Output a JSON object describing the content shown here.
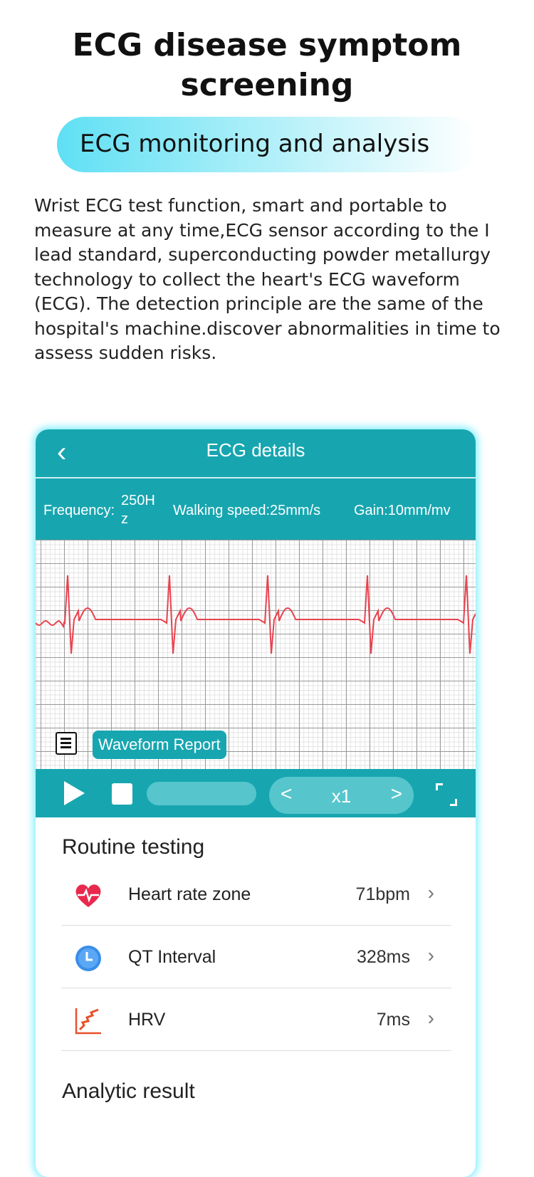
{
  "page": {
    "title": "ECG disease symptom screening",
    "subtitle": "ECG monitoring and analysis",
    "description": "Wrist ECG test function, smart and portable to measure at any time,ECG sensor according to the I lead standard, superconducting powder metallurgy technology to collect the heart's ECG waveform (ECG). The detection principle are the same of the hospital's machine.discover abnormalities in time to assess sudden risks."
  },
  "app": {
    "header_title": "ECG details",
    "back_icon": "chevron-left-icon",
    "info": {
      "frequency_label": "Frequency:",
      "frequency_value_top": "250H",
      "frequency_value_bottom": "z",
      "walking_speed": "Walking speed:25mm/s",
      "gain": "Gain:10mm/mv"
    },
    "waveform_report_label": "Waveform Report",
    "controls": {
      "speed_value": "x1",
      "prev": "<",
      "next": ">"
    },
    "routine_title": "Routine testing",
    "rows": [
      {
        "label": "Heart rate zone",
        "value": "71bpm",
        "icon": "heart-pulse-icon"
      },
      {
        "label": "QT Interval",
        "value": "328ms",
        "icon": "clock-icon"
      },
      {
        "label": "HRV",
        "value": "7ms",
        "icon": "hrv-chart-icon"
      }
    ],
    "chevron": "›",
    "analytic_title": "Analytic result"
  },
  "colors": {
    "teal": "#17a6b0",
    "ecg_line": "#e8434f",
    "glow": "#8ff0ff"
  }
}
